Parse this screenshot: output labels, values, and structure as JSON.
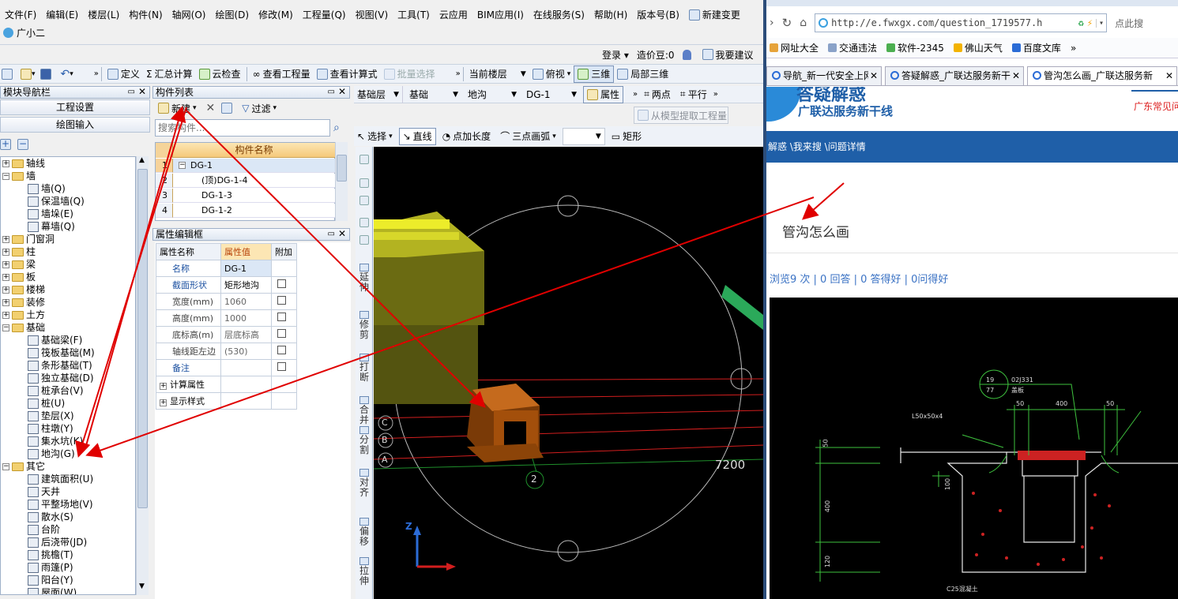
{
  "menu": [
    "文件(F)",
    "编辑(E)",
    "楼层(L)",
    "构件(N)",
    "轴网(O)",
    "绘图(D)",
    "修改(M)",
    "工程量(Q)",
    "视图(V)",
    "工具(T)",
    "云应用",
    "BIM应用(I)",
    "在线服务(S)",
    "帮助(H)",
    "版本号(B)",
    "新建变更"
  ],
  "assistant": "广小二",
  "toolbar1": {
    "login": "登录",
    "credits": "造价豆:0",
    "suggest": "我要建议"
  },
  "toolbar2": {
    "define": "定义",
    "calc": "汇总计算",
    "cloud": "云检查",
    "view_qty": "查看工程量",
    "view_formula": "查看计算式",
    "batch": "批量选择",
    "floor": "当前楼层",
    "top_view": "俯视",
    "three_d": "三维",
    "local_3d": "局部三维"
  },
  "nav": {
    "title": "模块导航栏",
    "project_settings": "工程设置",
    "draw_input": "绘图输入"
  },
  "tree": [
    {
      "label": "轴线",
      "type": "folder",
      "state": "+"
    },
    {
      "label": "墙",
      "type": "folder",
      "state": "-"
    },
    {
      "label": "墙(Q)",
      "type": "leaf"
    },
    {
      "label": "保温墙(Q)",
      "type": "leaf"
    },
    {
      "label": "墙垛(E)",
      "type": "leaf"
    },
    {
      "label": "幕墙(Q)",
      "type": "leaf"
    },
    {
      "label": "门窗洞",
      "type": "folder",
      "state": "+"
    },
    {
      "label": "柱",
      "type": "folder",
      "state": "+"
    },
    {
      "label": "梁",
      "type": "folder",
      "state": "+"
    },
    {
      "label": "板",
      "type": "folder",
      "state": "+"
    },
    {
      "label": "楼梯",
      "type": "folder",
      "state": "+"
    },
    {
      "label": "装修",
      "type": "folder",
      "state": "+"
    },
    {
      "label": "土方",
      "type": "folder",
      "state": "+"
    },
    {
      "label": "基础",
      "type": "folder",
      "state": "-"
    },
    {
      "label": "基础梁(F)",
      "type": "leaf"
    },
    {
      "label": "筏板基础(M)",
      "type": "leaf"
    },
    {
      "label": "条形基础(T)",
      "type": "leaf"
    },
    {
      "label": "独立基础(D)",
      "type": "leaf"
    },
    {
      "label": "桩承台(V)",
      "type": "leaf"
    },
    {
      "label": "桩(U)",
      "type": "leaf"
    },
    {
      "label": "垫层(X)",
      "type": "leaf"
    },
    {
      "label": "柱墩(Y)",
      "type": "leaf"
    },
    {
      "label": "集水坑(K)",
      "type": "leaf"
    },
    {
      "label": "地沟(G)",
      "type": "leaf"
    },
    {
      "label": "其它",
      "type": "folder",
      "state": "-"
    },
    {
      "label": "建筑面积(U)",
      "type": "leaf"
    },
    {
      "label": "天井",
      "type": "leaf"
    },
    {
      "label": "平整场地(V)",
      "type": "leaf"
    },
    {
      "label": "散水(S)",
      "type": "leaf"
    },
    {
      "label": "台阶",
      "type": "leaf"
    },
    {
      "label": "后浇带(JD)",
      "type": "leaf"
    },
    {
      "label": "挑檐(T)",
      "type": "leaf"
    },
    {
      "label": "雨篷(P)",
      "type": "leaf"
    },
    {
      "label": "阳台(Y)",
      "type": "leaf"
    },
    {
      "label": "屋面(W)",
      "type": "leaf"
    }
  ],
  "components": {
    "title": "构件列表",
    "new": "新建",
    "filter": "过滤",
    "search_placeholder": "搜索构件...",
    "col_name": "构件名称",
    "rows": [
      {
        "n": "1",
        "name": "DG-1"
      },
      {
        "n": "2",
        "name": "(顶)DG-1-4"
      },
      {
        "n": "3",
        "name": "DG-1-3"
      },
      {
        "n": "4",
        "name": "DG-1-2"
      }
    ]
  },
  "props": {
    "title": "属性编辑框",
    "col_name": "属性名称",
    "col_value": "属性值",
    "col_extra": "附加",
    "rows": [
      {
        "name": "名称",
        "value": "DG-1",
        "blue": true,
        "check": false
      },
      {
        "name": "截面形状",
        "value": "矩形地沟",
        "blue": true,
        "check": true
      },
      {
        "name": "宽度(mm)",
        "value": "1060",
        "blue": false,
        "check": true
      },
      {
        "name": "高度(mm)",
        "value": "1000",
        "blue": false,
        "check": true
      },
      {
        "name": "底标高(m)",
        "value": "层底标高",
        "blue": false,
        "check": true
      },
      {
        "name": "轴线距左边",
        "value": "(530)",
        "blue": false,
        "check": true
      },
      {
        "name": "备注",
        "value": "",
        "blue": true,
        "check": true
      }
    ],
    "groups": [
      "计算属性",
      "显示样式"
    ]
  },
  "draw_toolbar": {
    "floor": "基础层",
    "category": "基础",
    "type": "地沟",
    "item": "DG-1",
    "attr": "属性",
    "two_point": "两点",
    "parallel": "平行",
    "extract": "从模型提取工程量",
    "select": "选择",
    "line": "直线",
    "point_len": "点加长度",
    "arc": "三点画弧",
    "rect": "矩形"
  },
  "side_tools": [
    "延伸",
    "修剪",
    "打断",
    "合并",
    "分割",
    "对齐",
    "偏移",
    "拉伸"
  ],
  "viewport": {
    "dimension": "7200",
    "axis_letters": [
      "C",
      "B",
      "A"
    ],
    "axis_number": "2",
    "z_label": "Z"
  },
  "browser": {
    "url": "http://e.fwxgx.com/question_1719577.h",
    "search_hint": "点此搜",
    "bookmarks": [
      "网址大全",
      "交通违法",
      "软件-2345",
      "佛山天气",
      "百度文库"
    ],
    "tabs": [
      "导航_新一代安全上网",
      "答疑解惑_广联达服务新干",
      "管沟怎么画_广联达服务新"
    ],
    "brand_line1": "答疑解惑",
    "brand_line2": "广联达服务新干线",
    "side_link": "广东常见问",
    "breadcrumb": "解惑 \\我来搜 \\问题详情",
    "question": "管沟怎么画",
    "stats": "浏览9 次 | 0 回答 | 0 答得好 | 0问得好",
    "drawing": {
      "note1": "02J331",
      "note2": "盖板",
      "dim_50": "50",
      "dim_400": "400",
      "dim_120": "120",
      "dim_100": "100",
      "angle": "L50x50x4",
      "concrete": "C25混凝土",
      "ref": "19",
      "ref2": "77"
    }
  },
  "colors": {
    "accent": "#e00000",
    "brand_blue": "#1f5fa8",
    "viewport": "#000000"
  }
}
